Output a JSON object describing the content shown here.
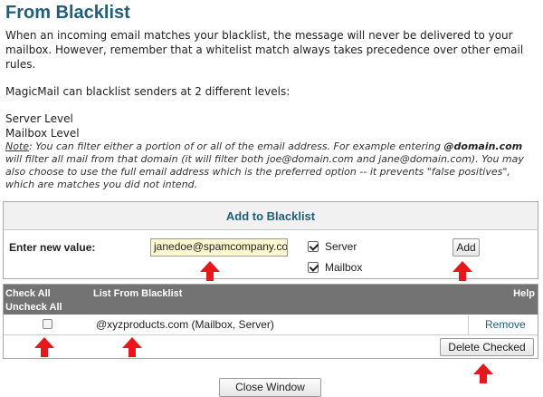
{
  "page": {
    "title": "From Blacklist",
    "intro_paragraph": "When an incoming email matches your blacklist, the message will never be delivered to your mailbox. However, remember that a whitelist match always takes precedence over other email rules.",
    "levels_intro": "MagicMail can blacklist senders at 2 different levels:",
    "levels": [
      "Server Level",
      "Mailbox Level"
    ]
  },
  "note": {
    "label": "Note",
    "text_before_bold": ": You can filter either a portion of or all of the email address. For example entering ",
    "bold": "@domain.com",
    "text_after_bold": " will filter all mail from that domain (it will filter both joe@domain.com and jane@domain.com). You may also choose to use the full email address which is the preferred option -- it prevents \"false positives\", which are matches you did not intend."
  },
  "add_form": {
    "header": "Add to Blacklist",
    "label": "Enter new value:",
    "input_value": "janedoe@spamcompany.com",
    "server_label": "Server",
    "server_checked": true,
    "mailbox_label": "Mailbox",
    "mailbox_checked": true,
    "add_button": "Add"
  },
  "list": {
    "check_all": "Check All",
    "uncheck_all": "Uncheck All",
    "column_title": "List From Blacklist",
    "help": "Help",
    "rows": [
      {
        "entry": "@xyzproducts.com (Mailbox, Server)",
        "checked": false,
        "action": "Remove"
      }
    ],
    "delete_button": "Delete Checked"
  },
  "footer": {
    "close_button": "Close Window"
  },
  "colors": {
    "title_blue": "#1f5f7a",
    "header_gray": "#737373",
    "input_highlight": "#fff7cf",
    "annotation_arrow": "#e8171c"
  }
}
